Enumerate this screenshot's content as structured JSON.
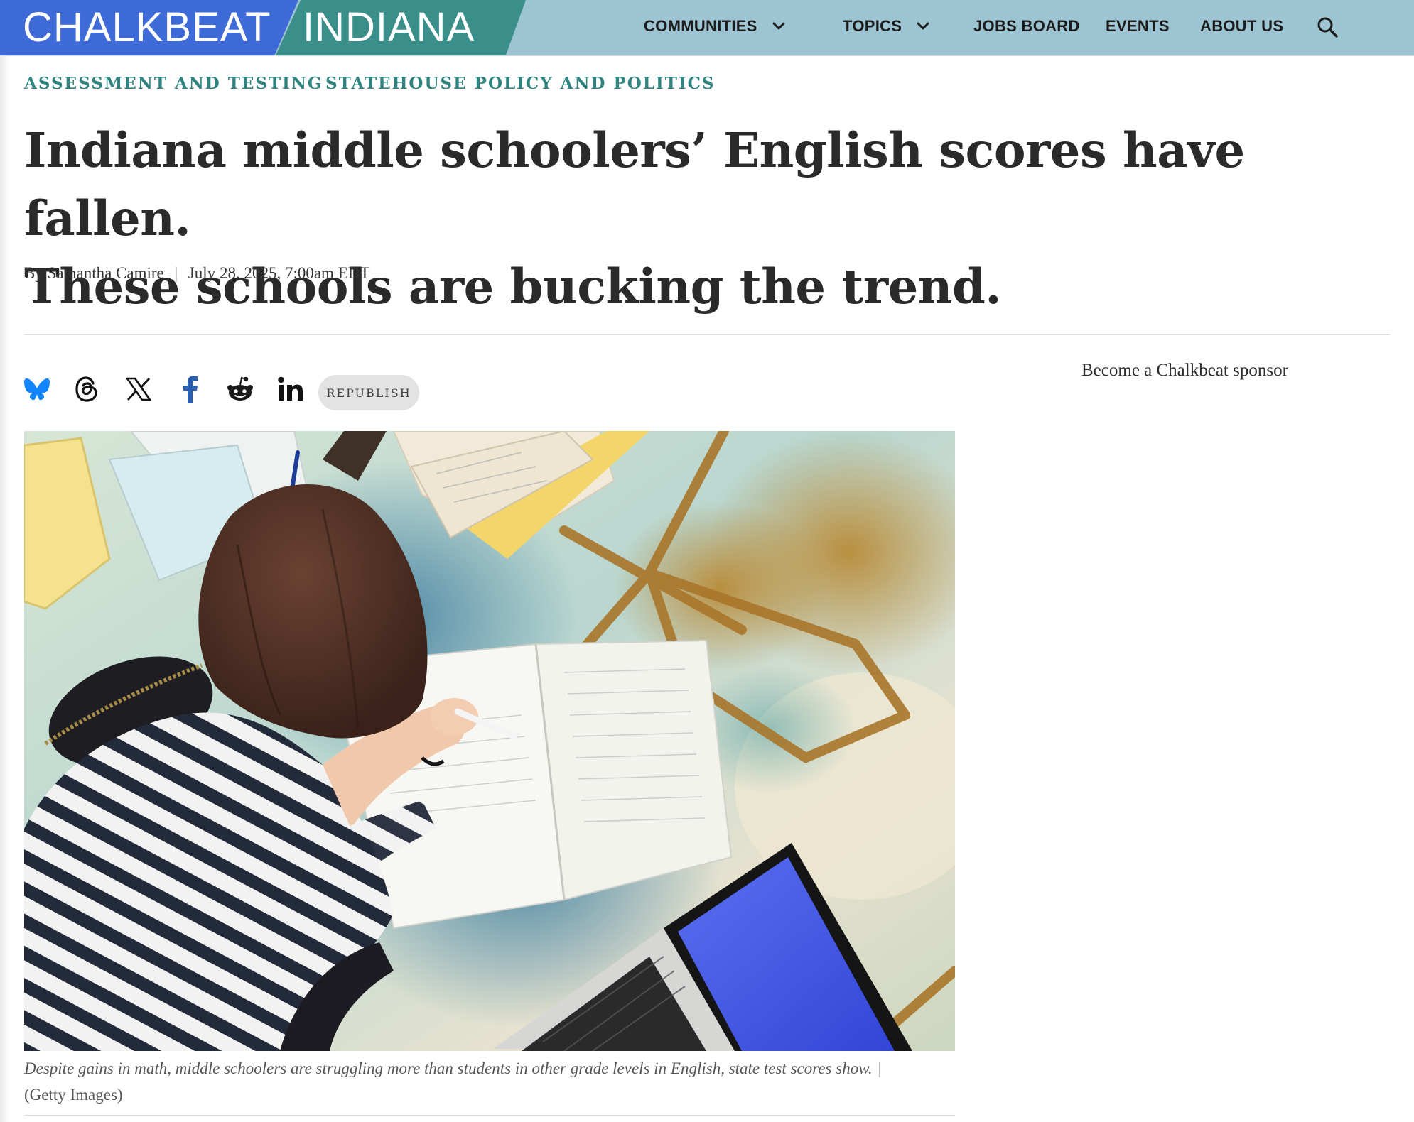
{
  "brand": {
    "primary": "CHALKBEAT",
    "secondary": "INDIANA",
    "colors": {
      "chalkbeat_blue": "#3f6bd8",
      "indiana_teal": "#3a8f8b",
      "nav_bg": "#9cc4d2",
      "category_teal": "#2f8480"
    }
  },
  "nav": {
    "items": [
      {
        "label": "COMMUNITIES",
        "dropdown": true
      },
      {
        "label": "TOPICS",
        "dropdown": true
      },
      {
        "label": "JOBS BOARD",
        "dropdown": false
      },
      {
        "label": "EVENTS",
        "dropdown": false
      },
      {
        "label": "ABOUT US",
        "dropdown": false
      }
    ],
    "search_icon": "search-icon"
  },
  "article": {
    "categories": [
      "ASSESSMENT AND TESTING",
      "STATEHOUSE POLICY AND POLITICS"
    ],
    "headline_line1": "Indiana middle schoolers’ English scores have fallen.",
    "headline_line2": "These schools are bucking the trend.",
    "byline_prefix": "By",
    "author": "Samantha Camire",
    "date": "July 28, 2025, 7:00am EDT",
    "caption": "Despite gains in math, middle schoolers are struggling more than students in other grade levels in English, state test scores show.",
    "credit": "(Getty Images)"
  },
  "share": {
    "icons": [
      "bluesky-icon",
      "threads-icon",
      "x-icon",
      "facebook-icon",
      "reddit-icon",
      "linkedin-icon"
    ],
    "republish_label": "REPUBLISH"
  },
  "sidebar": {
    "sponsor_label": "Become a Chalkbeat sponsor"
  }
}
